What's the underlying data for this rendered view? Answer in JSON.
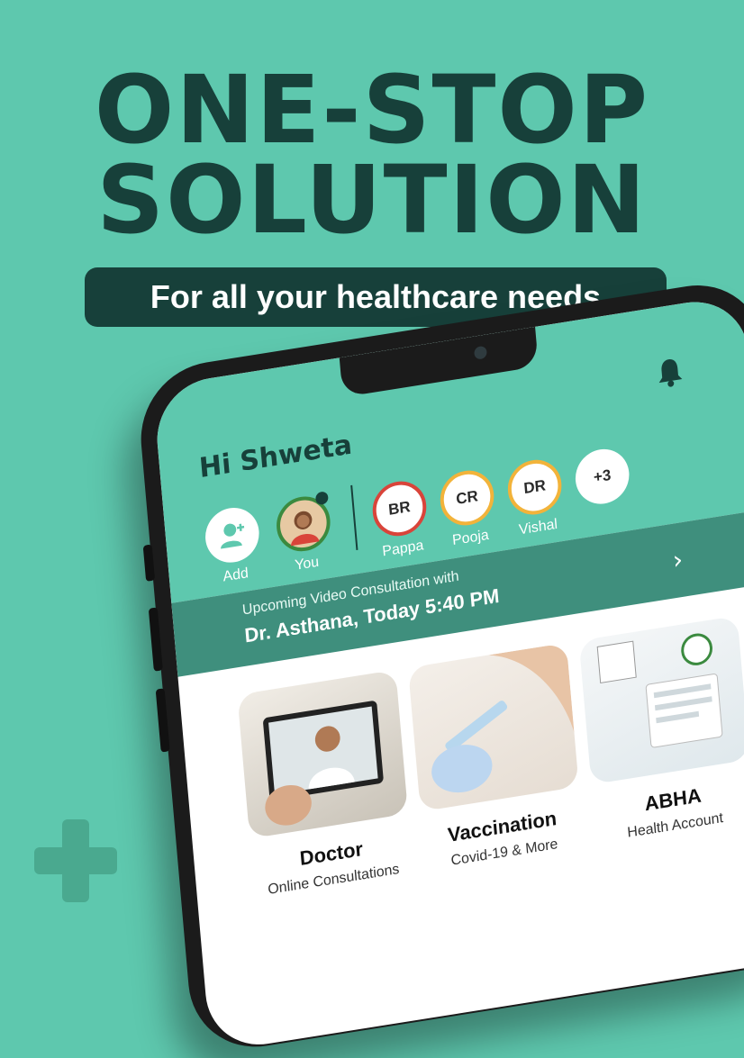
{
  "headline": {
    "line1": "ONE-STOP",
    "line2": "SOLUTION"
  },
  "tagline": "For all your healthcare needs",
  "app": {
    "greeting": "Hi Shweta",
    "family": [
      {
        "label": "Add",
        "initials": ""
      },
      {
        "label": "You",
        "initials": ""
      },
      {
        "label": "Pappa",
        "initials": "BR"
      },
      {
        "label": "Pooja",
        "initials": "CR"
      },
      {
        "label": "Vishal",
        "initials": "DR"
      },
      {
        "label": "",
        "initials": "+3"
      }
    ],
    "consultation": {
      "line1": "Upcoming Video Consultation with",
      "line2": "Dr. Asthana, Today 5:40 PM"
    },
    "services": [
      {
        "title": "Doctor",
        "subtitle": "Online Consultations"
      },
      {
        "title": "Vaccination",
        "subtitle": "Covid-19 & More"
      },
      {
        "title": "ABHA",
        "subtitle": "Health Account"
      }
    ]
  },
  "colors": {
    "background": "#5ec8ae",
    "dark_green": "#17403a",
    "banner": "#3f8f7d",
    "ring_red": "#d9443a",
    "ring_amber": "#f2b33a"
  },
  "icons": [
    "bell-icon",
    "add-person-icon",
    "chevron-right-icon",
    "plus-icon"
  ]
}
